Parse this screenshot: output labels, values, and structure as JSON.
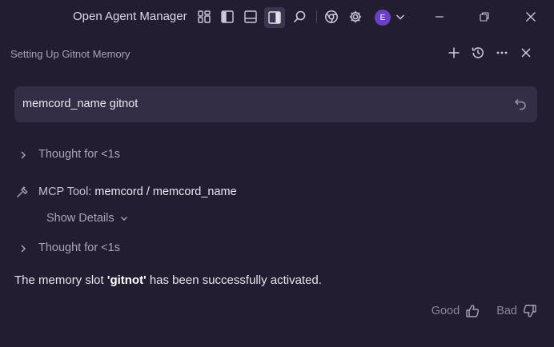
{
  "titlebar": {
    "app_title": "Open Agent Manager",
    "avatar_initial": "E"
  },
  "panel": {
    "title": "Setting Up Gitnot Memory"
  },
  "query": {
    "text": "memcord_name gitnot"
  },
  "steps": {
    "thought_1": "Thought for <1s",
    "tool_prefix": "MCP Tool:",
    "tool_name": "memcord / memcord_name",
    "show_details": "Show Details",
    "thought_2": "Thought for <1s"
  },
  "response": {
    "before": "The memory slot ",
    "slot_name": "'gitnot'",
    "after": " has been successfully activated."
  },
  "feedback": {
    "good_label": "Good",
    "bad_label": "Bad"
  },
  "colors": {
    "background": "#221d30",
    "query_box": "#332d45",
    "avatar": "#6b3fc6",
    "muted_text": "#aaa4ba"
  }
}
